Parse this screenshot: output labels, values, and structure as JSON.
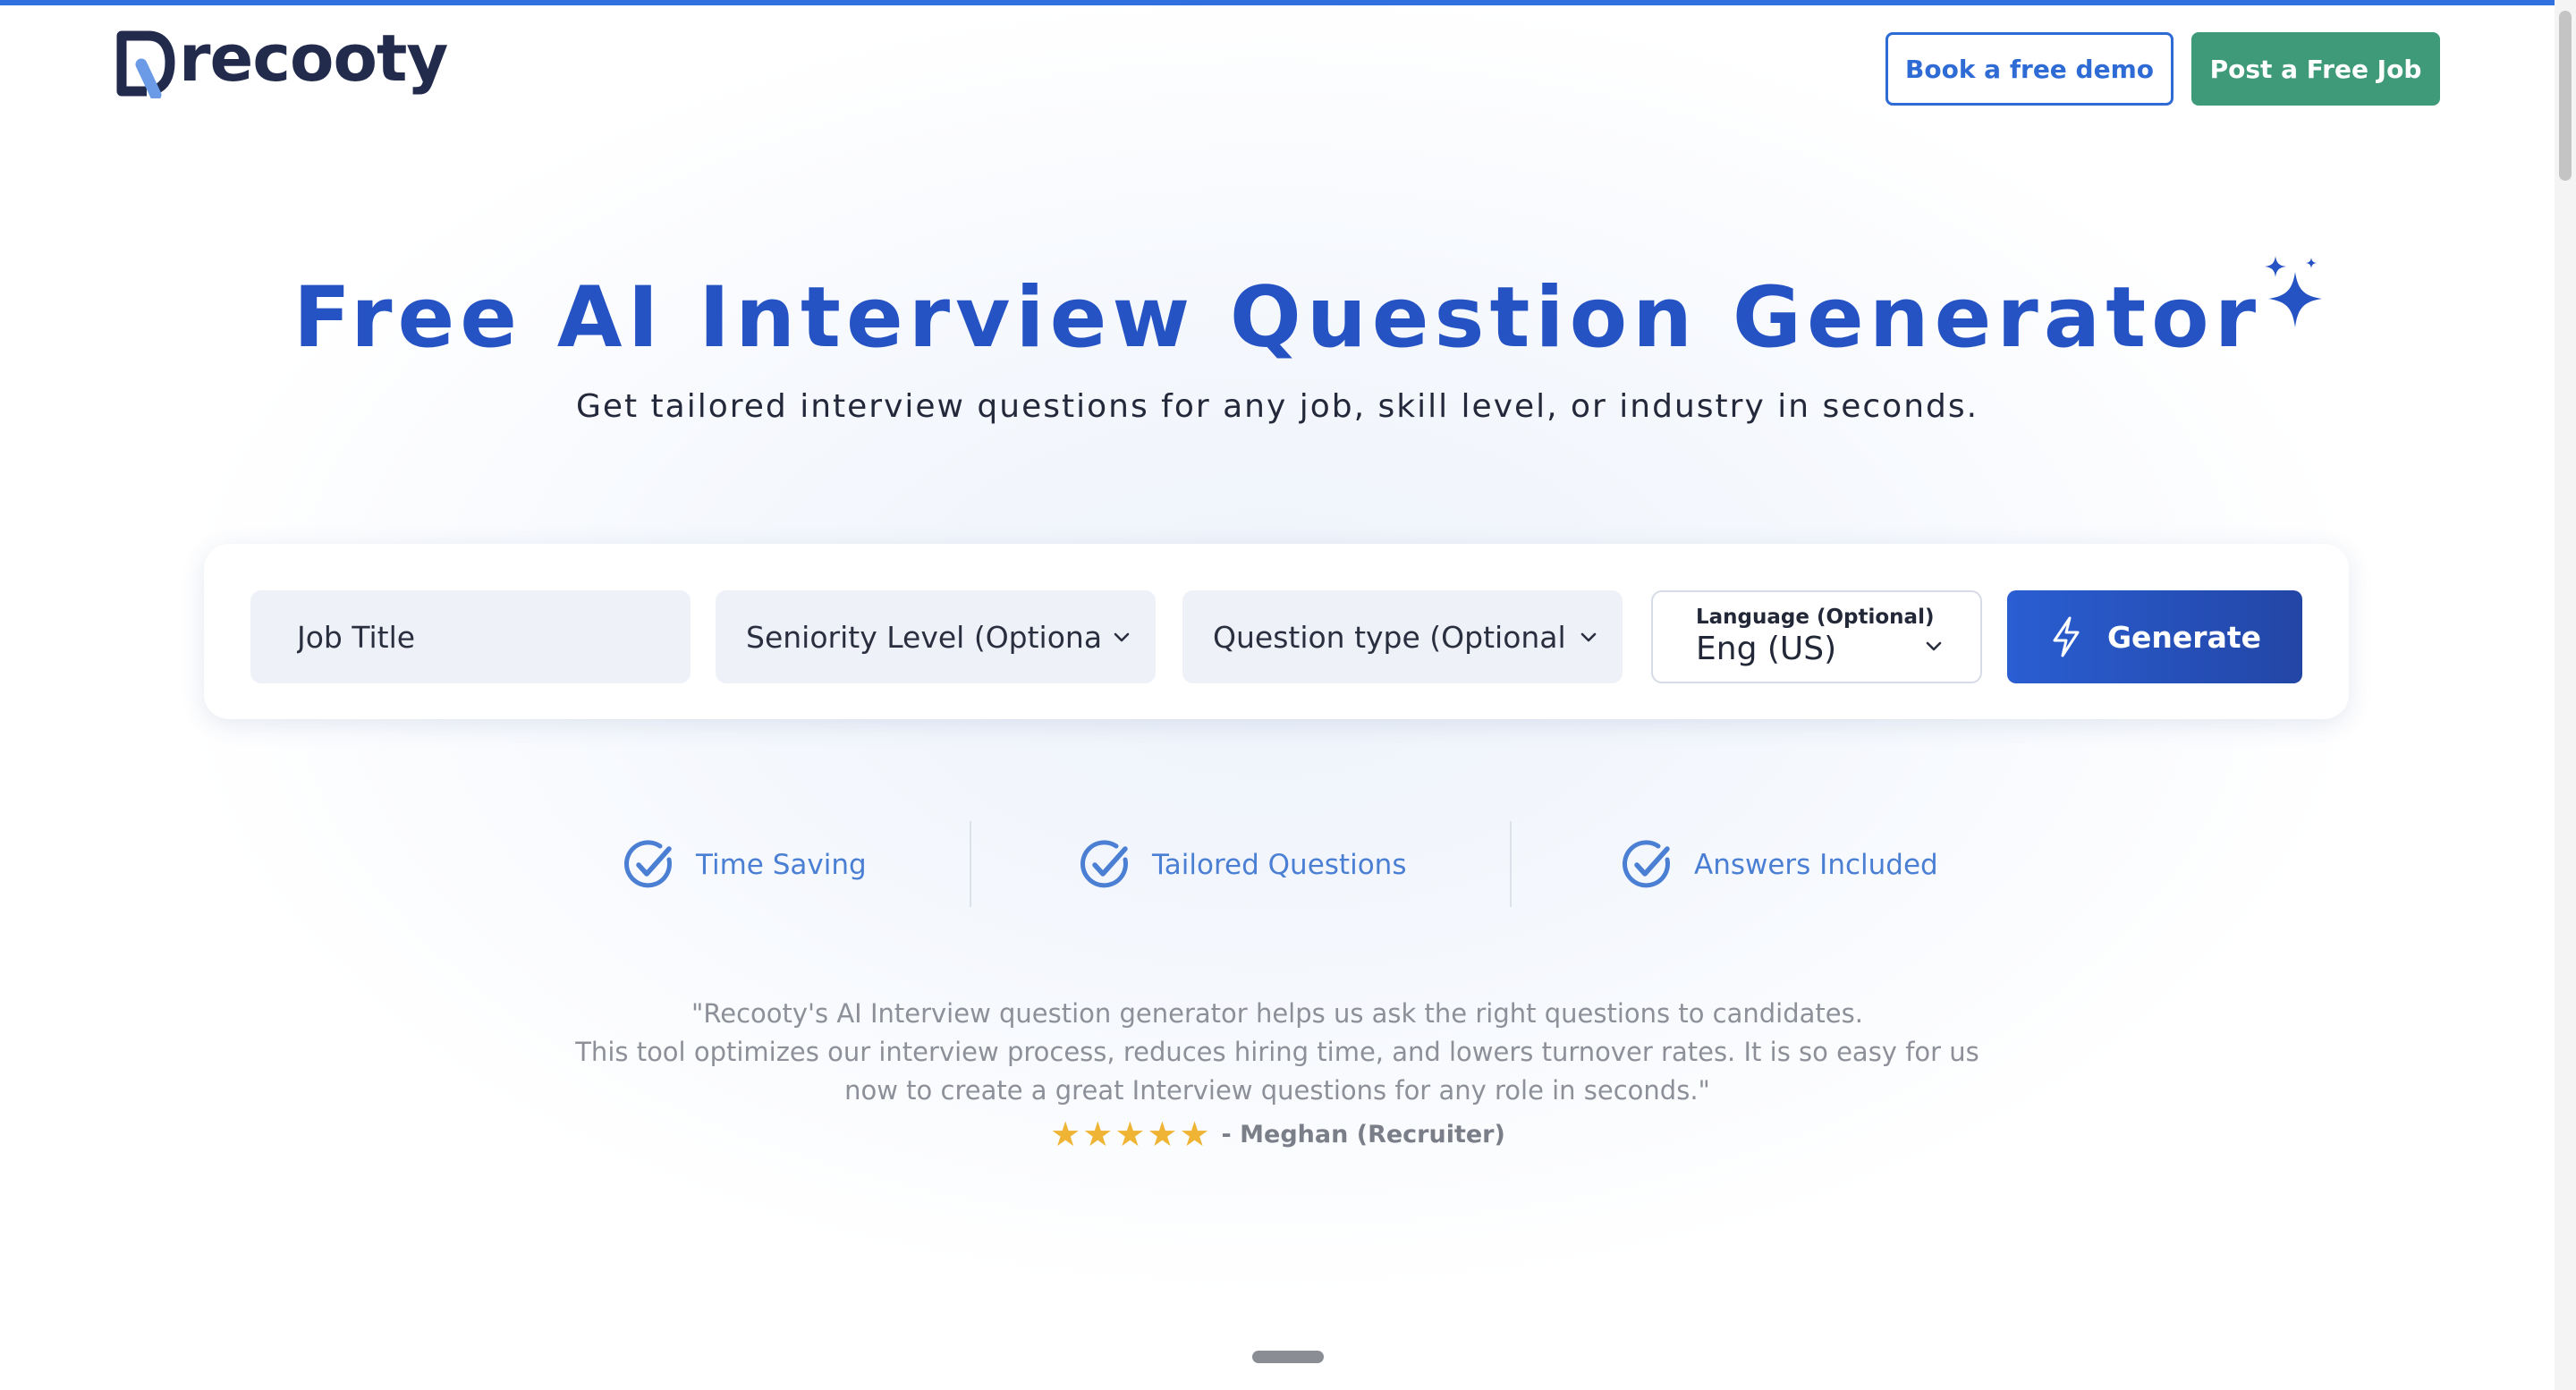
{
  "brand": {
    "name": "recooty",
    "accent_color": "#2f6fde",
    "primary_blue": "#2553c4",
    "green": "#3f9a79"
  },
  "header": {
    "demo_button": "Book a free demo",
    "post_job_button": "Post a Free Job"
  },
  "hero": {
    "title": "Free AI Interview Question Generator",
    "subtitle": "Get tailored interview questions for any job, skill level, or industry in seconds.",
    "title_icon": "sparkle-icon"
  },
  "form": {
    "job_title_placeholder": "Job Title",
    "seniority_value": "Seniority Level (Optional)",
    "question_type_value": "Question type (Optional)",
    "language_label": "Language (Optional)",
    "language_value": "Eng (US)",
    "generate_label": "Generate",
    "generate_icon": "bolt-icon"
  },
  "features": [
    {
      "label": "Time Saving",
      "icon": "check-circle-icon"
    },
    {
      "label": "Tailored Questions",
      "icon": "check-circle-icon"
    },
    {
      "label": "Answers Included",
      "icon": "check-circle-icon"
    }
  ],
  "testimonial": {
    "lines": [
      "\"Recooty's AI Interview question generator helps us ask the right questions to candidates.",
      "This tool optimizes our interview process, reduces hiring time, and lowers turnover rates. It is so easy for us",
      "now to create a great Interview questions for any role in seconds.\""
    ],
    "rating": 5,
    "rating_max": 5,
    "star_color": "#f0b434",
    "author": "- Meghan (Recruiter)"
  }
}
